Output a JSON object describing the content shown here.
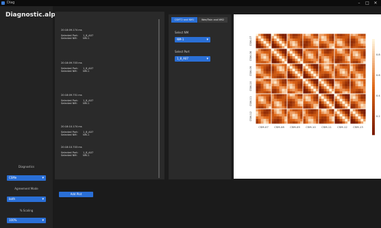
{
  "window": {
    "title": "Diag"
  },
  "sidebar": {
    "title": "Diagnostic.alpha",
    "controls": [
      {
        "label": "Diagnostics",
        "value": "CSMe"
      },
      {
        "label": "Agreement Mode",
        "value": "both"
      },
      {
        "label": "% Scaling",
        "value": "100%"
      }
    ]
  },
  "log": [
    {
      "time": "20:18:09.174 ms",
      "lines": [
        {
          "k": "Selected Port:",
          "v": "1_8_A07"
        },
        {
          "k": "Selected NM:",
          "v": "NM-1"
        }
      ]
    },
    {
      "time": "20:18:09.703 ms",
      "lines": [
        {
          "k": "Selected Port:",
          "v": "1_8_A07"
        },
        {
          "k": "Selected NM:",
          "v": "NM-1"
        }
      ]
    },
    {
      "time": "20:18:09.751 ms",
      "lines": [
        {
          "k": "Selected Port:",
          "v": "1_8_A07"
        },
        {
          "k": "Selected NM:",
          "v": "NM-1"
        }
      ]
    },
    {
      "time": "20:18:10.174 ms",
      "lines": [
        {
          "k": "Selected Port:",
          "v": "1_8_A07"
        },
        {
          "k": "Selected NM:",
          "v": "NM-1"
        }
      ]
    },
    {
      "time": "20:18:10.703 ms",
      "lines": [
        {
          "k": "Selected Port:",
          "v": "1_8_A07"
        },
        {
          "k": "Selected NM:",
          "v": "NM-1"
        }
      ]
    }
  ],
  "tabs": [
    "CSMT2 and NM1",
    "Wee/Twin and NM2"
  ],
  "controls": {
    "nm_label": "Select NM",
    "nm_value": "NM-1",
    "port_label": "Select Port",
    "port_value": "1_8_A07"
  },
  "add_plot_label": "Add Plot",
  "heatmap": {
    "row_labels": [
      "CSM-07",
      "CSM-08",
      "CSM-09",
      "CSM-10",
      "CSM-11",
      "CSM-12"
    ],
    "col_labels": [
      "CSM-07",
      "CSM-08",
      "CSM-09",
      "CSM-10",
      "CSM-11",
      "CSM-12",
      "CSM-13"
    ],
    "colorbar_ticks": [
      "0.8",
      "0.6",
      "0.4",
      "0.2"
    ]
  },
  "colors": {
    "accent": "#2a6fd6",
    "heat_low": "#7a1b00",
    "heat_high": "#fff4dc"
  }
}
